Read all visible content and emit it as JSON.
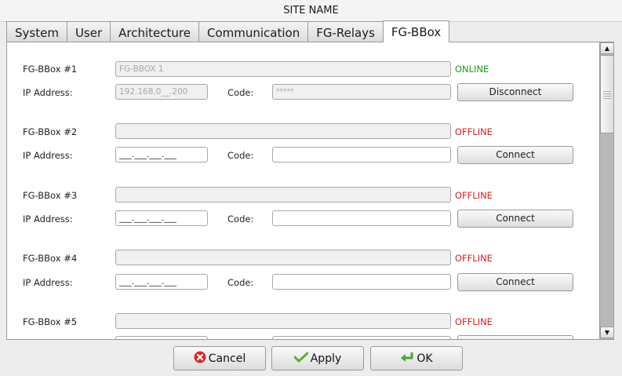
{
  "window": {
    "title": "SITE NAME"
  },
  "tabs": [
    {
      "label": "System"
    },
    {
      "label": "User"
    },
    {
      "label": "Architecture"
    },
    {
      "label": "Communication"
    },
    {
      "label": "FG-Relays"
    },
    {
      "label": "FG-BBox",
      "active": true
    }
  ],
  "devices": [
    {
      "label": "FG-BBox #1",
      "name_value": "FG-BBOX 1",
      "status": "ONLINE",
      "ip_label": "IP Address:",
      "ip_value": "192.168.0__.200",
      "code_label": "Code:",
      "code_value": "*****",
      "button": "Disconnect"
    },
    {
      "label": "FG-BBox #2",
      "name_value": "",
      "status": "OFFLINE",
      "ip_label": "IP Address:",
      "ip_value": "___.___.___.___",
      "code_label": "Code:",
      "code_value": "",
      "button": "Connect"
    },
    {
      "label": "FG-BBox #3",
      "name_value": "",
      "status": "OFFLINE",
      "ip_label": "IP Address:",
      "ip_value": "___.___.___.___",
      "code_label": "Code:",
      "code_value": "",
      "button": "Connect"
    },
    {
      "label": "FG-BBox #4",
      "name_value": "",
      "status": "OFFLINE",
      "ip_label": "IP Address:",
      "ip_value": "___.___.___.___",
      "code_label": "Code:",
      "code_value": "",
      "button": "Connect"
    },
    {
      "label": "FG-BBox #5",
      "name_value": "",
      "status": "OFFLINE"
    }
  ],
  "footer": {
    "cancel": "Cancel",
    "apply": "Apply",
    "ok": "OK"
  },
  "colors": {
    "online": "#1f9a1f",
    "offline": "#d52020"
  },
  "icons": {
    "cancel": "cancel-x-icon",
    "apply": "checkmark-icon",
    "ok": "return-arrow-icon"
  }
}
